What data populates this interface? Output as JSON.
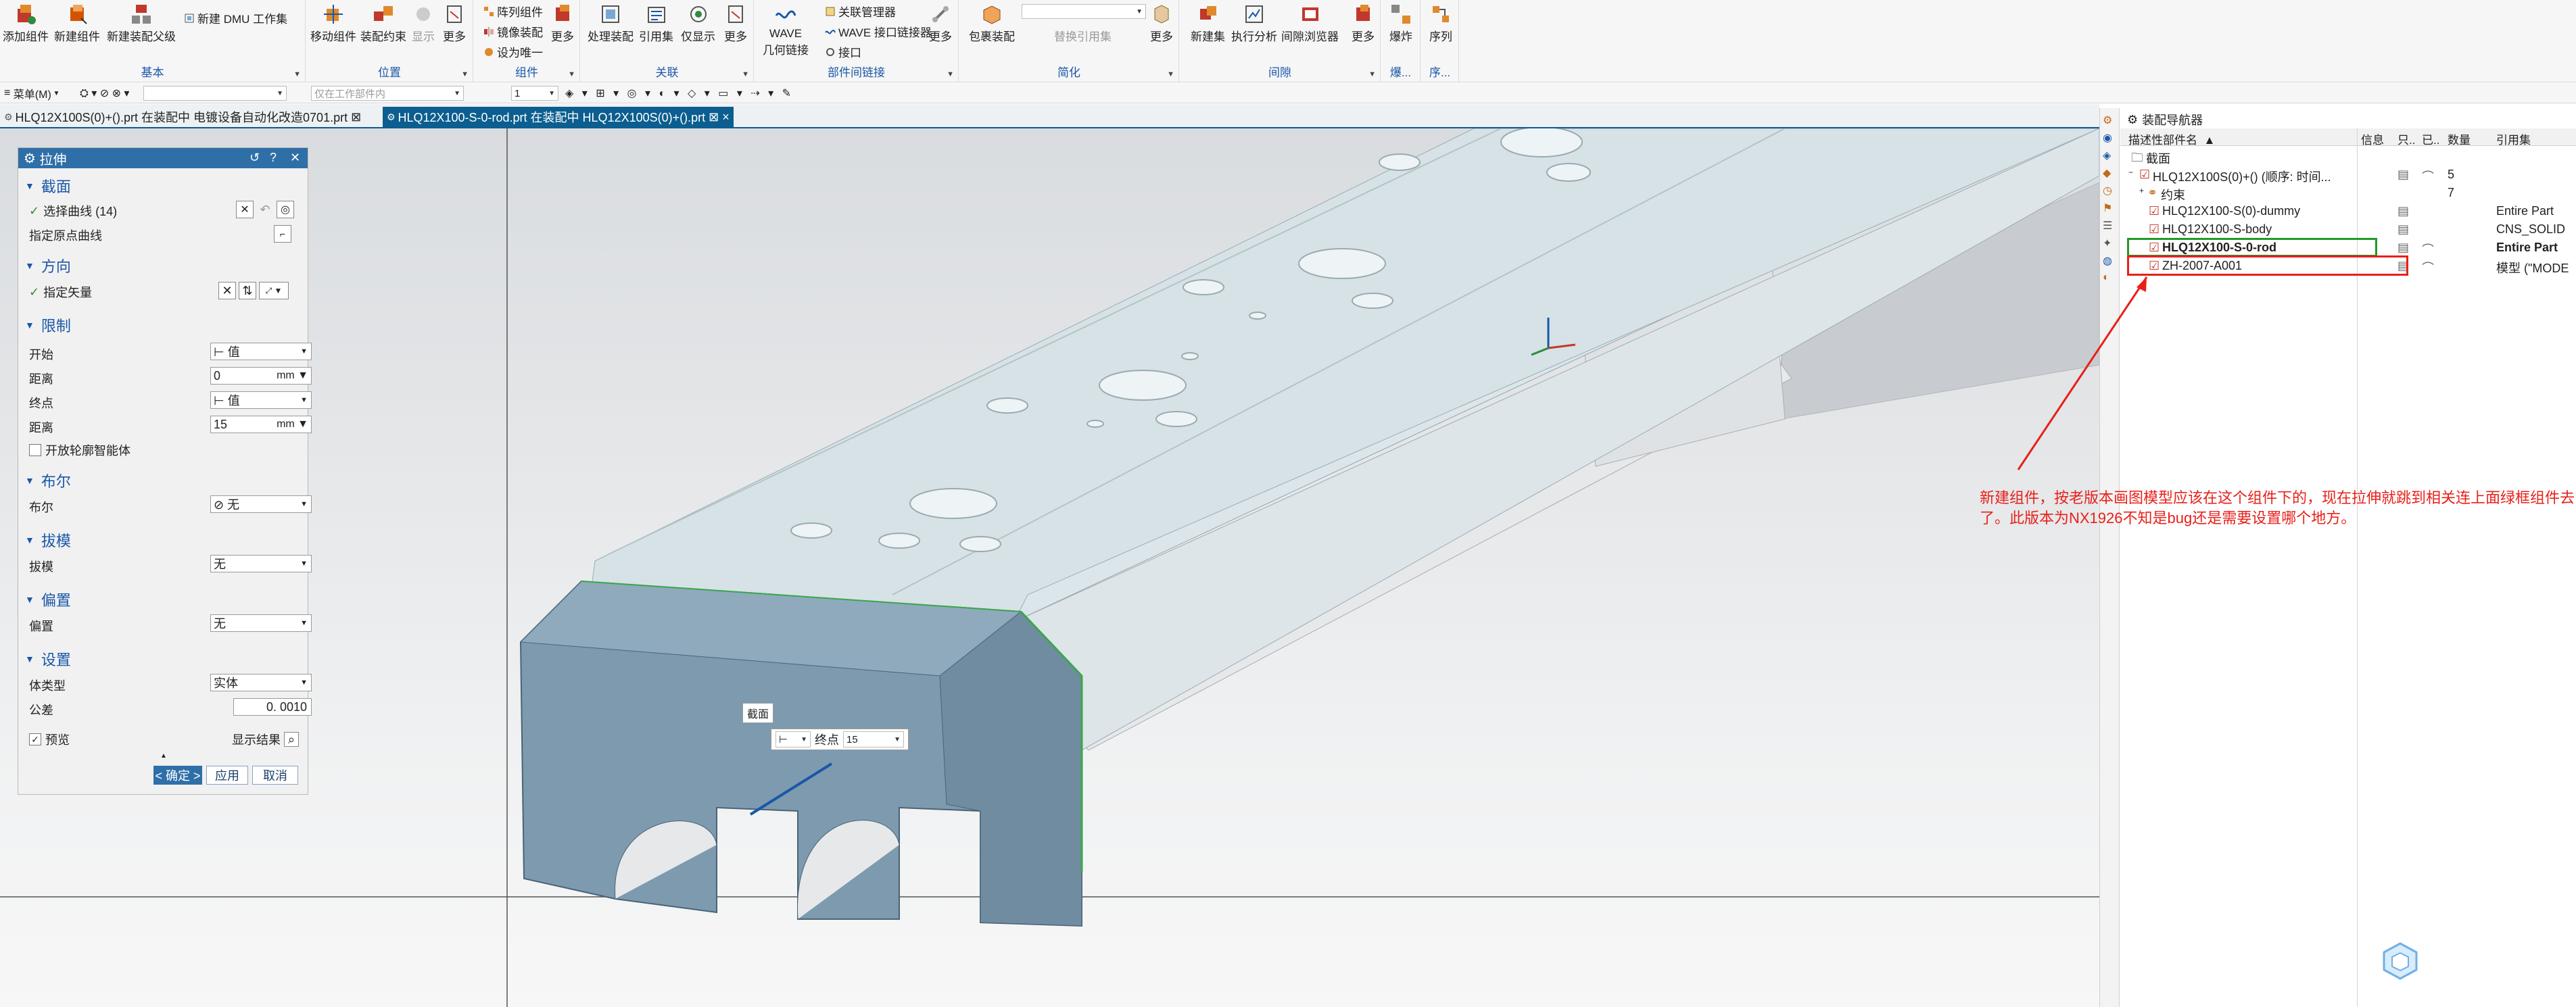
{
  "ribbon": {
    "groups": [
      {
        "title": "基本",
        "buttons": [
          "添加组件",
          "新建组件",
          "新建装配父级"
        ],
        "small": [
          "新建 DMU 工作集"
        ]
      },
      {
        "title": "位置",
        "buttons": [
          "移动组件",
          "装配约束",
          "显示",
          "更多"
        ]
      },
      {
        "title": "组件",
        "small": [
          "阵列组件",
          "镜像装配",
          "设为唯一"
        ],
        "buttons": [
          "更多"
        ]
      },
      {
        "title": "关联",
        "buttons": [
          "处理装配",
          "引用集",
          "仅显示",
          "更多"
        ]
      },
      {
        "title": "部件间链接",
        "buttons": [
          "WAVE",
          "几何链接"
        ],
        "small": [
          "关联管理器",
          "WAVE 接口链接器",
          "接口"
        ],
        "more": "更多"
      },
      {
        "title": "简化",
        "buttons": [
          "包裹装配",
          "替换引用集",
          "更多"
        ]
      },
      {
        "title": "间隙",
        "buttons": [
          "新建集",
          "执行分析",
          "间隙浏览器",
          "更多"
        ]
      },
      {
        "title": "爆...",
        "buttons": [
          "爆炸"
        ]
      },
      {
        "title": "序...",
        "buttons": [
          "序列"
        ]
      }
    ]
  },
  "toolbar2": {
    "menu": "菜单(M)",
    "filter_placeholder": "仅在工作部件内",
    "count": "1"
  },
  "tabs": [
    {
      "label": "HLQ12X100S(0)+().prt 在装配中 电镀设备自动化改造0701.prt",
      "close": "⊠",
      "active": false
    },
    {
      "label": "HLQ12X100-S-0-rod.prt 在装配中 HLQ12X100S(0)+().prt",
      "close": "⊠ ×",
      "active": true
    }
  ],
  "dialog": {
    "title": "拉伸",
    "sections": {
      "section": {
        "title": "截面",
        "select_curve": "选择曲线 (14)",
        "origin_curve": "指定原点曲线"
      },
      "direction": {
        "title": "方向",
        "vector": "指定矢量"
      },
      "limits": {
        "title": "限制",
        "start_label": "开始",
        "start_value": "值",
        "dist1_label": "距离",
        "dist1_value": "0",
        "dist1_unit": "mm",
        "end_label": "终点",
        "end_value": "值",
        "dist2_label": "距离",
        "dist2_value": "15",
        "dist2_unit": "mm",
        "open_profile": "开放轮廓智能体"
      },
      "boolean": {
        "title": "布尔",
        "label": "布尔",
        "value": "无"
      },
      "draft": {
        "title": "拔模",
        "label": "拔模",
        "value": "无"
      },
      "offset": {
        "title": "偏置",
        "label": "偏置",
        "value": "无"
      },
      "settings": {
        "title": "设置",
        "body_type_label": "体类型",
        "body_type_value": "实体",
        "tolerance_label": "公差",
        "tolerance_value": "0. 0010"
      }
    },
    "preview": "预览",
    "show_result": "显示结果",
    "ok": "< 确定 >",
    "apply": "应用",
    "cancel": "取消"
  },
  "viewport": {
    "section_label": "截面",
    "end_label": "终点",
    "end_value": "15"
  },
  "navigator": {
    "title": "装配导航器",
    "columns": [
      "描述性部件名",
      "信息",
      "只..",
      "已..",
      "数量",
      "引用集"
    ],
    "rows": [
      {
        "name": "截面",
        "qty": "",
        "ref": "",
        "bold": false
      },
      {
        "name": "HLQ12X100S(0)+() (顺序: 时间...",
        "qty": "5",
        "ref": "",
        "bold": false
      },
      {
        "name": "约束",
        "qty": "7",
        "ref": "",
        "bold": false
      },
      {
        "name": "HLQ12X100-S(0)-dummy",
        "qty": "",
        "ref": "Entire Part",
        "bold": false
      },
      {
        "name": "HLQ12X100-S-body",
        "qty": "",
        "ref": "CNS_SOLID",
        "bold": false
      },
      {
        "name": "HLQ12X100-S-0-rod",
        "qty": "",
        "ref": "Entire Part",
        "bold": true
      },
      {
        "name": "ZH-2007-A001",
        "qty": "",
        "ref": "模型 (\"MODE",
        "bold": false
      }
    ]
  },
  "annotation": "新建组件，按老版本画图模型应该在这个组件下的，现在拉伸就跳到相关连上面绿框组件去了。此版本为NX1926不知是bug还是需要设置哪个地方。",
  "colors": {
    "accent": "#2f6fa8",
    "tab_active": "#0b5e8f",
    "annotation": "#e8201a",
    "green_box": "#1f9a2a"
  }
}
